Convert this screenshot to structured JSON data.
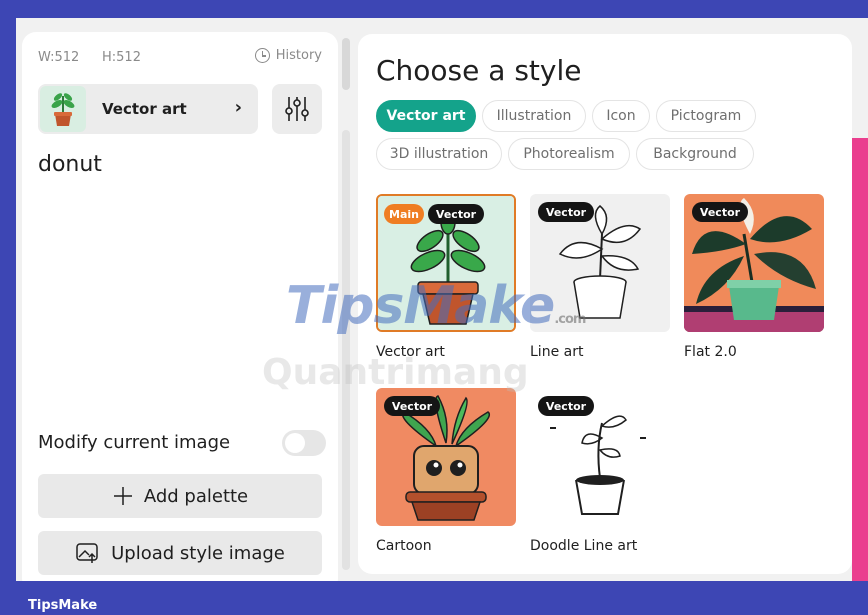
{
  "left_panel": {
    "width_label": "W:512",
    "height_label": "H:512",
    "history_label": "History",
    "selected_style": "Vector art",
    "prompt": "donut",
    "modify_label": "Modify current image",
    "add_palette_label": "Add palette",
    "upload_style_label": "Upload style image"
  },
  "right_panel": {
    "title": "Choose a style",
    "chips": [
      {
        "label": "Vector art",
        "active": true
      },
      {
        "label": "Illustration",
        "active": false
      },
      {
        "label": "Icon",
        "active": false
      },
      {
        "label": "Pictogram",
        "active": false
      },
      {
        "label": "3D illustration",
        "active": false
      },
      {
        "label": "Photorealism",
        "active": false
      },
      {
        "label": "Background",
        "active": false
      }
    ],
    "cards": [
      {
        "label": "Vector art",
        "badges": [
          "Main",
          "Vector"
        ]
      },
      {
        "label": "Line art",
        "badges": [
          "Vector"
        ]
      },
      {
        "label": "Flat 2.0",
        "badges": [
          "Vector"
        ]
      },
      {
        "label": "Cartoon",
        "badges": [
          "Vector"
        ]
      },
      {
        "label": "Doodle Line art",
        "badges": [
          "Vector"
        ]
      }
    ]
  },
  "watermarks": {
    "primary": "TipsMake",
    "primary_suffix": ".com",
    "secondary": "Quantrimang"
  },
  "footer": {
    "brand": "TipsMake"
  },
  "colors": {
    "frame": "#3d46b4",
    "accent": "#14a38b",
    "main_badge": "#ef7d22",
    "selected_border": "#e07b26"
  }
}
